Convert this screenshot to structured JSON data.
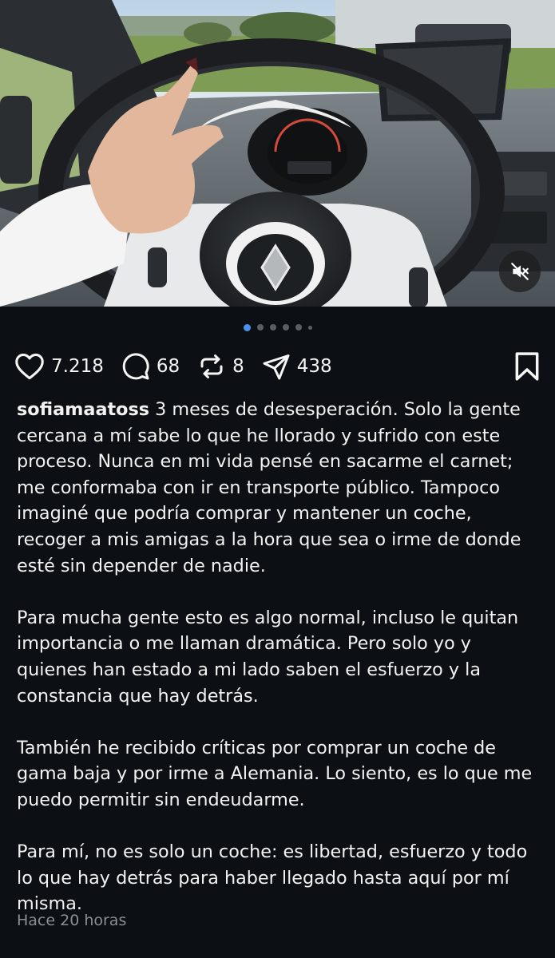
{
  "post": {
    "username": "sofiamaatoss",
    "caption_paragraphs": [
      "3 meses de desesperación. Solo la gente cercana a mí sabe lo que he llorado y sufrido con este proceso. Nunca en mi vida pensé en sacarme el carnet; me conformaba con ir en transporte público. Tampoco imaginé que podría comprar y mantener un coche, recoger a mis amigas a la hora que sea o irme de donde esté sin depender de nadie.",
      "Para mucha gente esto es algo normal, incluso le quitan importancia o me llaman dramática. Pero solo yo y quienes han estado a mi lado saben el esfuerzo y la constancia que hay detrás.",
      "También he recibido críticas por comprar un coche de gama baja y por irme a Alemania. Lo siento, es lo que me puedo permitir sin endeudarme.",
      "Para mí, no es solo un coche: es libertad, esfuerzo y todo lo que hay detrás para haber llegado hasta aquí por mí misma."
    ],
    "timestamp": "Hace 20 horas"
  },
  "actions": {
    "likes": "7.218",
    "comments": "68",
    "reposts": "8",
    "shares": "438"
  },
  "carousel": {
    "total_dots": 6,
    "active_index": 0
  },
  "icons": {
    "like": "heart-icon",
    "comment": "comment-bubble-icon",
    "repost": "repost-icon",
    "share": "paper-plane-icon",
    "save": "bookmark-icon",
    "mute": "speaker-muted-icon"
  },
  "colors": {
    "background": "#0c1014",
    "text": "#f5f5f5",
    "muted_text": "#8a8f94",
    "dot_active": "#4a90f0"
  }
}
